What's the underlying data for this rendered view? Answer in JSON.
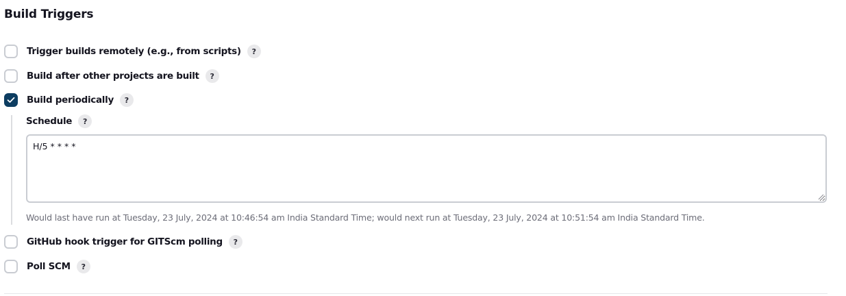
{
  "section": {
    "title": "Build Triggers"
  },
  "triggers": [
    {
      "label": "Trigger builds remotely (e.g., from scripts)",
      "checked": false,
      "help": "?"
    },
    {
      "label": "Build after other projects are built",
      "checked": false,
      "help": "?"
    },
    {
      "label": "Build periodically",
      "checked": true,
      "help": "?"
    },
    {
      "label": "GitHub hook trigger for GITScm polling",
      "checked": false,
      "help": "?"
    },
    {
      "label": "Poll SCM",
      "checked": false,
      "help": "?"
    }
  ],
  "schedule": {
    "label": "Schedule",
    "help": "?",
    "value": "H/5 * * * *",
    "hint": "Would last have run at Tuesday, 23 July, 2024 at 10:46:54 am India Standard Time; would next run at Tuesday, 23 July, 2024 at 10:51:54 am India Standard Time."
  },
  "colors": {
    "checked_fill": "#0d3d61",
    "checkbox_border": "#c9ccd2",
    "help_bg": "#e9e9eb",
    "hint_text": "#6c6d78"
  }
}
